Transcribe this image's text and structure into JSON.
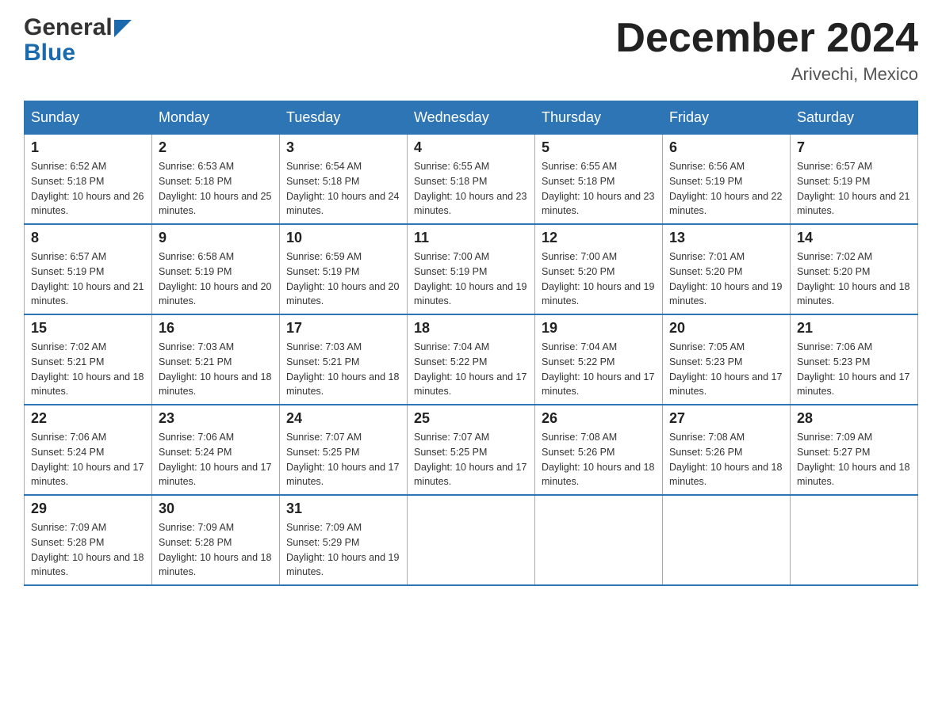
{
  "header": {
    "logo_part1": "General",
    "logo_part2": "Blue",
    "month_title": "December 2024",
    "location": "Arivechi, Mexico"
  },
  "days_of_week": [
    "Sunday",
    "Monday",
    "Tuesday",
    "Wednesday",
    "Thursday",
    "Friday",
    "Saturday"
  ],
  "weeks": [
    [
      {
        "day": "1",
        "sunrise": "6:52 AM",
        "sunset": "5:18 PM",
        "daylight": "10 hours and 26 minutes."
      },
      {
        "day": "2",
        "sunrise": "6:53 AM",
        "sunset": "5:18 PM",
        "daylight": "10 hours and 25 minutes."
      },
      {
        "day": "3",
        "sunrise": "6:54 AM",
        "sunset": "5:18 PM",
        "daylight": "10 hours and 24 minutes."
      },
      {
        "day": "4",
        "sunrise": "6:55 AM",
        "sunset": "5:18 PM",
        "daylight": "10 hours and 23 minutes."
      },
      {
        "day": "5",
        "sunrise": "6:55 AM",
        "sunset": "5:18 PM",
        "daylight": "10 hours and 23 minutes."
      },
      {
        "day": "6",
        "sunrise": "6:56 AM",
        "sunset": "5:19 PM",
        "daylight": "10 hours and 22 minutes."
      },
      {
        "day": "7",
        "sunrise": "6:57 AM",
        "sunset": "5:19 PM",
        "daylight": "10 hours and 21 minutes."
      }
    ],
    [
      {
        "day": "8",
        "sunrise": "6:57 AM",
        "sunset": "5:19 PM",
        "daylight": "10 hours and 21 minutes."
      },
      {
        "day": "9",
        "sunrise": "6:58 AM",
        "sunset": "5:19 PM",
        "daylight": "10 hours and 20 minutes."
      },
      {
        "day": "10",
        "sunrise": "6:59 AM",
        "sunset": "5:19 PM",
        "daylight": "10 hours and 20 minutes."
      },
      {
        "day": "11",
        "sunrise": "7:00 AM",
        "sunset": "5:19 PM",
        "daylight": "10 hours and 19 minutes."
      },
      {
        "day": "12",
        "sunrise": "7:00 AM",
        "sunset": "5:20 PM",
        "daylight": "10 hours and 19 minutes."
      },
      {
        "day": "13",
        "sunrise": "7:01 AM",
        "sunset": "5:20 PM",
        "daylight": "10 hours and 19 minutes."
      },
      {
        "day": "14",
        "sunrise": "7:02 AM",
        "sunset": "5:20 PM",
        "daylight": "10 hours and 18 minutes."
      }
    ],
    [
      {
        "day": "15",
        "sunrise": "7:02 AM",
        "sunset": "5:21 PM",
        "daylight": "10 hours and 18 minutes."
      },
      {
        "day": "16",
        "sunrise": "7:03 AM",
        "sunset": "5:21 PM",
        "daylight": "10 hours and 18 minutes."
      },
      {
        "day": "17",
        "sunrise": "7:03 AM",
        "sunset": "5:21 PM",
        "daylight": "10 hours and 18 minutes."
      },
      {
        "day": "18",
        "sunrise": "7:04 AM",
        "sunset": "5:22 PM",
        "daylight": "10 hours and 17 minutes."
      },
      {
        "day": "19",
        "sunrise": "7:04 AM",
        "sunset": "5:22 PM",
        "daylight": "10 hours and 17 minutes."
      },
      {
        "day": "20",
        "sunrise": "7:05 AM",
        "sunset": "5:23 PM",
        "daylight": "10 hours and 17 minutes."
      },
      {
        "day": "21",
        "sunrise": "7:06 AM",
        "sunset": "5:23 PM",
        "daylight": "10 hours and 17 minutes."
      }
    ],
    [
      {
        "day": "22",
        "sunrise": "7:06 AM",
        "sunset": "5:24 PM",
        "daylight": "10 hours and 17 minutes."
      },
      {
        "day": "23",
        "sunrise": "7:06 AM",
        "sunset": "5:24 PM",
        "daylight": "10 hours and 17 minutes."
      },
      {
        "day": "24",
        "sunrise": "7:07 AM",
        "sunset": "5:25 PM",
        "daylight": "10 hours and 17 minutes."
      },
      {
        "day": "25",
        "sunrise": "7:07 AM",
        "sunset": "5:25 PM",
        "daylight": "10 hours and 17 minutes."
      },
      {
        "day": "26",
        "sunrise": "7:08 AM",
        "sunset": "5:26 PM",
        "daylight": "10 hours and 18 minutes."
      },
      {
        "day": "27",
        "sunrise": "7:08 AM",
        "sunset": "5:26 PM",
        "daylight": "10 hours and 18 minutes."
      },
      {
        "day": "28",
        "sunrise": "7:09 AM",
        "sunset": "5:27 PM",
        "daylight": "10 hours and 18 minutes."
      }
    ],
    [
      {
        "day": "29",
        "sunrise": "7:09 AM",
        "sunset": "5:28 PM",
        "daylight": "10 hours and 18 minutes."
      },
      {
        "day": "30",
        "sunrise": "7:09 AM",
        "sunset": "5:28 PM",
        "daylight": "10 hours and 18 minutes."
      },
      {
        "day": "31",
        "sunrise": "7:09 AM",
        "sunset": "5:29 PM",
        "daylight": "10 hours and 19 minutes."
      },
      null,
      null,
      null,
      null
    ]
  ]
}
